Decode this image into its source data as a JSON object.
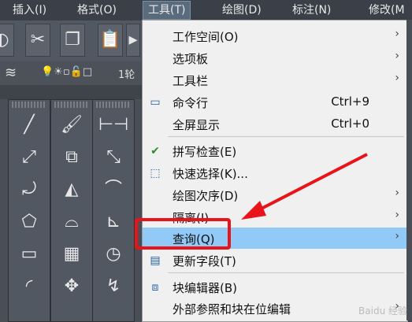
{
  "menubar": {
    "items": [
      {
        "label": "插入(I)"
      },
      {
        "label": "格式(O)"
      },
      {
        "label": "工具(T)"
      },
      {
        "label": "绘图(D)"
      },
      {
        "label": "标注(N)"
      },
      {
        "label": "修改(M"
      }
    ]
  },
  "layerbar": {
    "text": "1轮"
  },
  "tools_menu": {
    "items": [
      {
        "label": "工作空间(O)",
        "shortcut": "",
        "submenu": "›"
      },
      {
        "label": "选项板",
        "shortcut": "",
        "submenu": "›"
      },
      {
        "label": "工具栏",
        "shortcut": "",
        "submenu": "›"
      },
      {
        "label": "命令行",
        "shortcut": "Ctrl+9",
        "submenu": ""
      },
      {
        "label": "全屏显示",
        "shortcut": "Ctrl+0",
        "submenu": ""
      },
      {
        "label": "拼写检查(E)",
        "shortcut": "",
        "submenu": ""
      },
      {
        "label": "快速选择(K)...",
        "shortcut": "",
        "submenu": ""
      },
      {
        "label": "绘图次序(D)",
        "shortcut": "",
        "submenu": "›"
      },
      {
        "label": "隔离(I)",
        "shortcut": "",
        "submenu": "›"
      },
      {
        "label": "查询(Q)",
        "shortcut": "",
        "submenu": "›"
      },
      {
        "label": "更新字段(T)",
        "shortcut": "",
        "submenu": ""
      },
      {
        "label": "块编辑器(B)",
        "shortcut": "",
        "submenu": ""
      },
      {
        "label": "外部参照和块在位编辑",
        "shortcut": "",
        "submenu": "›"
      }
    ],
    "highlighted_index": 9,
    "highlight_color": "#91c9f7"
  },
  "annotation": {
    "box_color": "#e8141a",
    "arrow_color": "#e8141a"
  },
  "watermark": "Baidu 经验"
}
